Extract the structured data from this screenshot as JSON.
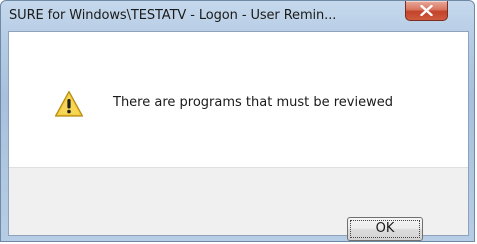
{
  "window": {
    "title": "SURE for Windows\\TESTATV - Logon - User Remin...",
    "close_icon": "close-x-icon"
  },
  "dialog": {
    "icon": "warning-icon",
    "message": "There are programs that must be reviewed"
  },
  "buttons": {
    "ok_label": "OK"
  },
  "colors": {
    "titlebar": "#b4cbe4",
    "close_button": "#c2432a",
    "warning": "#f2c431",
    "button_area": "#f0f0f0"
  }
}
